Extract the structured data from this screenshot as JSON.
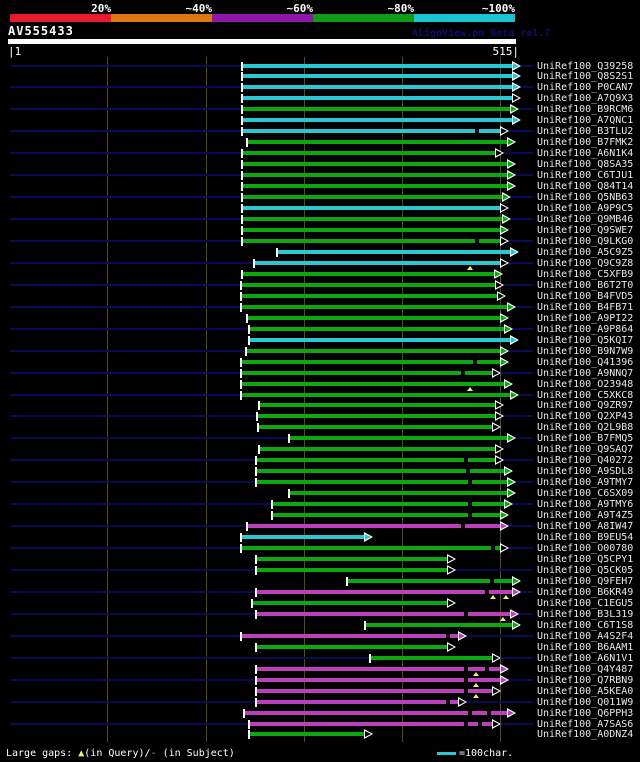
{
  "header": {
    "query_id": "AV555433",
    "app_credit": "AlignView.pm Beta rel.7"
  },
  "footer": {
    "gaps_prefix": "Large gaps: ",
    "query_gap_symbol": "▲",
    "query_gap_text": "(in Query)/",
    "subject_gap_symbol": "-",
    "subject_gap_text": " (in Subject)",
    "scale_legend": "=100char."
  },
  "colors": {
    "cyan": "#29c6d4",
    "green": "#0ba810",
    "magenta": "#bc3fbc",
    "yellow": "#f0ee7a",
    "navy": "#0b0b55",
    "grid": "#4e4e1e",
    "white": "#ffffff"
  },
  "chart_data": {
    "type": "bar",
    "subtype": "blast-alignment-overview",
    "title": "AV555433",
    "query_length": 515,
    "x_axis": {
      "start_label": "|1",
      "end_label": "515|",
      "gridline_positions": [
        100,
        200,
        300,
        400,
        500
      ]
    },
    "identity_scale": [
      {
        "label": "20%",
        "color": "#e91a2c"
      },
      {
        "label": "~40%",
        "color": "#dd7711"
      },
      {
        "label": "~60%",
        "color": "#8d18a8"
      },
      {
        "label": "~80%",
        "color": "#0e9c16"
      },
      {
        "label": "~100%",
        "color": "#18c4d2"
      }
    ],
    "grade_legend": {
      "cyan": "~80-100% identity",
      "green": "~60-80% identity",
      "magenta": "~40-60% identity"
    },
    "rows": [
      {
        "id": "UniRef100_Q39258",
        "grade": "cyan",
        "start": 238,
        "end": 512,
        "arrow": "filled"
      },
      {
        "id": "UniRef100_Q8S2S1",
        "grade": "cyan",
        "start": 238,
        "end": 512,
        "arrow": "filled"
      },
      {
        "id": "UniRef100_P0CAN7",
        "grade": "cyan",
        "start": 238,
        "end": 512,
        "arrow": "filled"
      },
      {
        "id": "UniRef100_A7Q9X3",
        "grade": "cyan",
        "start": 238,
        "end": 512,
        "arrow": "hollow"
      },
      {
        "id": "UniRef100_B9RCM6",
        "grade": "green",
        "start": 238,
        "end": 510,
        "arrow": "filled"
      },
      {
        "id": "UniRef100_A7QNC1",
        "grade": "cyan",
        "start": 238,
        "end": 512,
        "arrow": "filled"
      },
      {
        "id": "UniRef100_B3TLU2",
        "grade": "cyan",
        "start": 238,
        "end": 500,
        "arrow": "hollow",
        "marks": [
          {
            "type": "subject_gap",
            "pos": 476
          }
        ]
      },
      {
        "id": "UniRef100_B7FMK2",
        "grade": "green",
        "start": 243,
        "end": 507,
        "arrow": "filled"
      },
      {
        "id": "UniRef100_A6N1K4",
        "grade": "green",
        "start": 238,
        "end": 495,
        "arrow": "hollow"
      },
      {
        "id": "UniRef100_Q8SA35",
        "grade": "green",
        "start": 238,
        "end": 507,
        "arrow": "filled"
      },
      {
        "id": "UniRef100_C6TJU1",
        "grade": "green",
        "start": 238,
        "end": 507,
        "arrow": "filled"
      },
      {
        "id": "UniRef100_Q84T14",
        "grade": "green",
        "start": 238,
        "end": 507,
        "arrow": "filled"
      },
      {
        "id": "UniRef100_Q5NB63",
        "grade": "green",
        "start": 238,
        "end": 502,
        "arrow": "filled"
      },
      {
        "id": "UniRef100_A9P9C5",
        "grade": "cyan",
        "start": 238,
        "end": 500,
        "arrow": "hollow"
      },
      {
        "id": "UniRef100_Q9MB46",
        "grade": "green",
        "start": 238,
        "end": 502,
        "arrow": "filled"
      },
      {
        "id": "UniRef100_Q9SWE7",
        "grade": "green",
        "start": 238,
        "end": 500,
        "arrow": "filled"
      },
      {
        "id": "UniRef100_Q9LKG0",
        "grade": "green",
        "start": 238,
        "end": 500,
        "arrow": "hollow",
        "marks": [
          {
            "type": "subject_gap",
            "pos": 476
          }
        ]
      },
      {
        "id": "UniRef100_A5C9Z5",
        "grade": "cyan",
        "start": 274,
        "end": 510,
        "arrow": "filled"
      },
      {
        "id": "UniRef100_Q9C9Z8",
        "grade": "cyan",
        "start": 250,
        "end": 500,
        "arrow": "hollow",
        "marks": [
          {
            "type": "query_gap",
            "pos": 469
          }
        ]
      },
      {
        "id": "UniRef100_C5XFB9",
        "grade": "green",
        "start": 238,
        "end": 494,
        "arrow": "filled"
      },
      {
        "id": "UniRef100_B6T2T0",
        "grade": "green",
        "start": 237,
        "end": 495,
        "arrow": "hollow"
      },
      {
        "id": "UniRef100_B4FVD5",
        "grade": "green",
        "start": 237,
        "end": 497,
        "arrow": "hollow"
      },
      {
        "id": "UniRef100_B4FB71",
        "grade": "green",
        "start": 237,
        "end": 507,
        "arrow": "filled"
      },
      {
        "id": "UniRef100_A9PI22",
        "grade": "green",
        "start": 243,
        "end": 500,
        "arrow": "filled"
      },
      {
        "id": "UniRef100_A9P864",
        "grade": "green",
        "start": 245,
        "end": 504,
        "arrow": "filled"
      },
      {
        "id": "UniRef100_Q5KQI7",
        "grade": "cyan",
        "start": 245,
        "end": 510,
        "arrow": "filled"
      },
      {
        "id": "UniRef100_B9N7W9",
        "grade": "green",
        "start": 242,
        "end": 500,
        "arrow": "filled"
      },
      {
        "id": "UniRef100_Q41396",
        "grade": "green",
        "start": 237,
        "end": 500,
        "arrow": "filled",
        "marks": [
          {
            "type": "subject_gap",
            "pos": 474
          }
        ]
      },
      {
        "id": "UniRef100_A9NNQ7",
        "grade": "green",
        "start": 237,
        "end": 492,
        "arrow": "hollow",
        "marks": [
          {
            "type": "subject_gap",
            "pos": 462
          }
        ]
      },
      {
        "id": "UniRef100_O23948",
        "grade": "green",
        "start": 237,
        "end": 504,
        "arrow": "filled",
        "marks": [
          {
            "type": "query_gap",
            "pos": 469
          }
        ]
      },
      {
        "id": "UniRef100_C5XKC8",
        "grade": "green",
        "start": 237,
        "end": 510,
        "arrow": "filled"
      },
      {
        "id": "UniRef100_Q9ZR97",
        "grade": "green",
        "start": 255,
        "end": 495,
        "arrow": "hollow"
      },
      {
        "id": "UniRef100_Q2XP43",
        "grade": "green",
        "start": 253,
        "end": 495,
        "arrow": "hollow"
      },
      {
        "id": "UniRef100_Q2L9B8",
        "grade": "green",
        "start": 254,
        "end": 492,
        "arrow": "hollow"
      },
      {
        "id": "UniRef100_B7FMQ5",
        "grade": "green",
        "start": 286,
        "end": 507,
        "arrow": "filled"
      },
      {
        "id": "UniRef100_Q9SAQ7",
        "grade": "green",
        "start": 255,
        "end": 495,
        "arrow": "hollow"
      },
      {
        "id": "UniRef100_Q40272",
        "grade": "green",
        "start": 252,
        "end": 495,
        "arrow": "hollow",
        "marks": [
          {
            "type": "subject_gap",
            "pos": 465
          }
        ]
      },
      {
        "id": "UniRef100_A9SDL8",
        "grade": "green",
        "start": 252,
        "end": 504,
        "arrow": "filled",
        "marks": [
          {
            "type": "subject_gap",
            "pos": 467
          }
        ]
      },
      {
        "id": "UniRef100_A9TMY7",
        "grade": "green",
        "start": 252,
        "end": 507,
        "arrow": "filled",
        "marks": [
          {
            "type": "subject_gap",
            "pos": 469
          }
        ]
      },
      {
        "id": "UniRef100_C6SX09",
        "grade": "green",
        "start": 286,
        "end": 507,
        "arrow": "filled"
      },
      {
        "id": "UniRef100_A9TMY6",
        "grade": "green",
        "start": 269,
        "end": 504,
        "arrow": "filled",
        "marks": [
          {
            "type": "subject_gap",
            "pos": 469
          }
        ]
      },
      {
        "id": "UniRef100_A9T4Z5",
        "grade": "green",
        "start": 269,
        "end": 500,
        "arrow": "filled",
        "marks": [
          {
            "type": "subject_gap",
            "pos": 469
          }
        ]
      },
      {
        "id": "UniRef100_A8IW47",
        "grade": "magenta",
        "start": 243,
        "end": 500,
        "arrow": "filled",
        "marks": [
          {
            "type": "subject_gap",
            "pos": 462
          }
        ]
      },
      {
        "id": "UniRef100_B9EU54",
        "grade": "cyan",
        "start": 237,
        "end": 361,
        "arrow": "filled"
      },
      {
        "id": "UniRef100_O00780",
        "grade": "green",
        "start": 237,
        "end": 500,
        "arrow": "hollow",
        "marks": [
          {
            "type": "subject_gap",
            "pos": 493
          }
        ]
      },
      {
        "id": "UniRef100_Q5CPY1",
        "grade": "green",
        "start": 252,
        "end": 446,
        "arrow": "hollow"
      },
      {
        "id": "UniRef100_Q5CK05",
        "grade": "green",
        "start": 252,
        "end": 446,
        "arrow": "hollow"
      },
      {
        "id": "UniRef100_Q9FEH7",
        "grade": "green",
        "start": 345,
        "end": 512,
        "arrow": "filled",
        "marks": [
          {
            "type": "subject_gap",
            "pos": 492
          }
        ]
      },
      {
        "id": "UniRef100_B6KR49",
        "grade": "magenta",
        "start": 252,
        "end": 512,
        "arrow": "filled",
        "marks": [
          {
            "type": "subject_gap",
            "pos": 487
          },
          {
            "type": "query_gap",
            "pos": 493
          },
          {
            "type": "query_gap",
            "pos": 506
          }
        ]
      },
      {
        "id": "UniRef100_C1EGU5",
        "grade": "green",
        "start": 248,
        "end": 446,
        "arrow": "hollow"
      },
      {
        "id": "UniRef100_B3L319",
        "grade": "magenta",
        "start": 252,
        "end": 510,
        "arrow": "filled",
        "marks": [
          {
            "type": "subject_gap",
            "pos": 465
          },
          {
            "type": "query_gap",
            "pos": 503
          }
        ]
      },
      {
        "id": "UniRef100_C6T1S8",
        "grade": "green",
        "start": 363,
        "end": 512,
        "arrow": "filled"
      },
      {
        "id": "UniRef100_A4S2F4",
        "grade": "magenta",
        "start": 237,
        "end": 457,
        "arrow": "filled",
        "marks": [
          {
            "type": "subject_gap",
            "pos": 447
          }
        ]
      },
      {
        "id": "UniRef100_B6AAM1",
        "grade": "green",
        "start": 252,
        "end": 446,
        "arrow": "hollow"
      },
      {
        "id": "UniRef100_A6N1V1",
        "grade": "green",
        "start": 368,
        "end": 492,
        "arrow": "hollow"
      },
      {
        "id": "UniRef100_Q4Y487",
        "grade": "magenta",
        "start": 252,
        "end": 500,
        "arrow": "filled",
        "marks": [
          {
            "type": "subject_gap",
            "pos": 465
          },
          {
            "type": "query_gap",
            "pos": 475
          },
          {
            "type": "subject_gap",
            "pos": 487
          }
        ]
      },
      {
        "id": "UniRef100_Q7RBN9",
        "grade": "magenta",
        "start": 252,
        "end": 500,
        "arrow": "filled",
        "marks": [
          {
            "type": "subject_gap",
            "pos": 465
          },
          {
            "type": "query_gap",
            "pos": 475
          }
        ]
      },
      {
        "id": "UniRef100_A5KEA0",
        "grade": "magenta",
        "start": 252,
        "end": 492,
        "arrow": "hollow",
        "marks": [
          {
            "type": "subject_gap",
            "pos": 465
          },
          {
            "type": "query_gap",
            "pos": 475
          }
        ]
      },
      {
        "id": "UniRef100_Q011W9",
        "grade": "magenta",
        "start": 252,
        "end": 457,
        "arrow": "hollow",
        "marks": [
          {
            "type": "subject_gap",
            "pos": 447
          }
        ]
      },
      {
        "id": "UniRef100_Q6PPH3",
        "grade": "magenta",
        "start": 240,
        "end": 507,
        "arrow": "filled",
        "marks": [
          {
            "type": "subject_gap",
            "pos": 469
          },
          {
            "type": "subject_gap",
            "pos": 489
          }
        ]
      },
      {
        "id": "UniRef100_A7SAS6",
        "grade": "magenta",
        "start": 245,
        "end": 492,
        "arrow": "hollow",
        "marks": [
          {
            "type": "subject_gap",
            "pos": 465
          },
          {
            "type": "subject_gap",
            "pos": 479
          }
        ]
      },
      {
        "id": "UniRef100_A0DNZ4",
        "grade": "green",
        "start": 245,
        "end": 361,
        "arrow": "hollow"
      }
    ]
  }
}
